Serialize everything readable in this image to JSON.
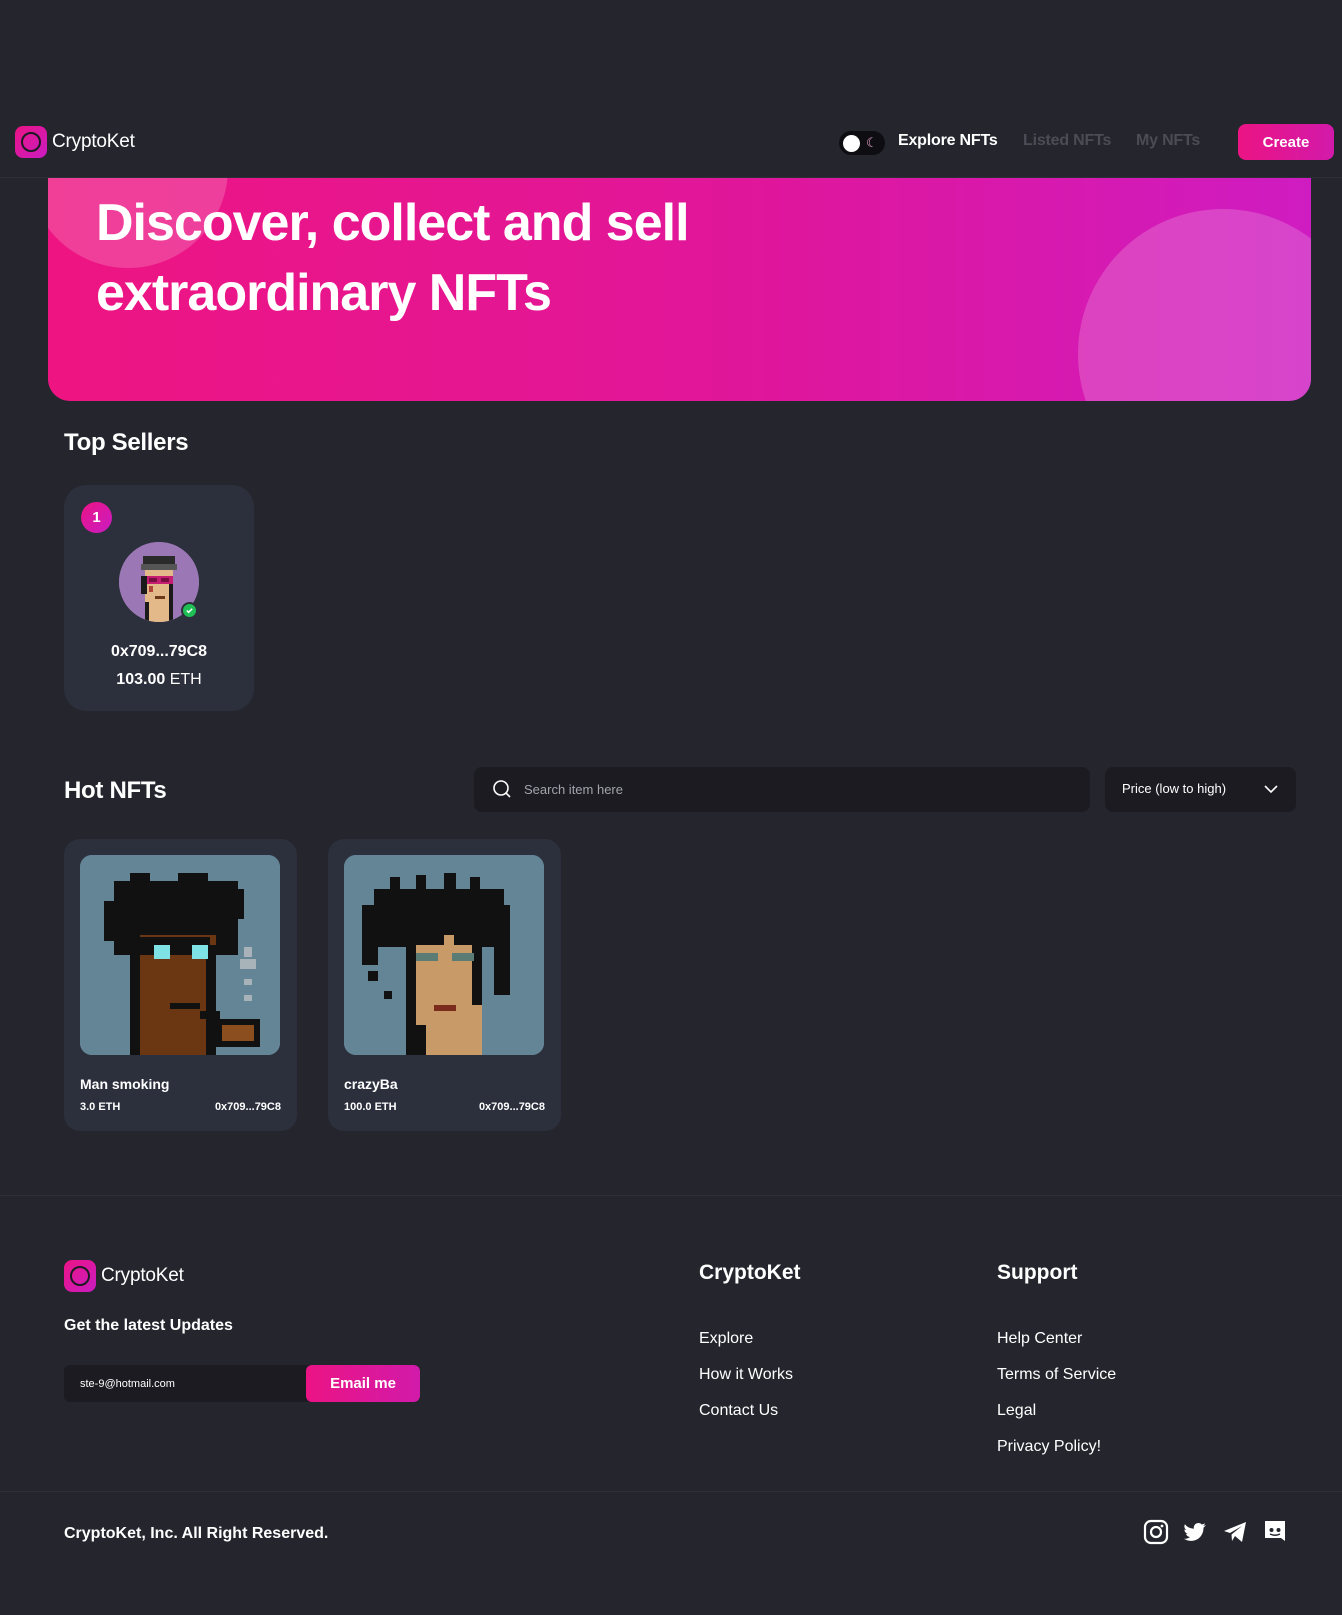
{
  "brand": {
    "name": "CryptoKet"
  },
  "nav": {
    "links": [
      {
        "label": "Explore NFTs",
        "active": true
      },
      {
        "label": "Listed NFTs",
        "active": false
      },
      {
        "label": "My NFTs",
        "active": false
      }
    ],
    "create_label": "Create",
    "theme_icon": "moon-icon"
  },
  "hero": {
    "title_line1": "Discover, collect and sell",
    "title_line2": "extraordinary NFTs"
  },
  "top_sellers": {
    "title": "Top Sellers",
    "sellers": [
      {
        "rank": "1",
        "address": "0x709...79C8",
        "amount": "103.00",
        "currency": "ETH",
        "verified": true
      }
    ]
  },
  "hot_nfts": {
    "title": "Hot NFTs",
    "search": {
      "placeholder": "Search item here",
      "value": ""
    },
    "sort": {
      "selected": "Price (low to high)"
    },
    "items": [
      {
        "name": "Man smoking",
        "price": "3.0 ETH",
        "owner": "0x709...79C8"
      },
      {
        "name": "crazyBa",
        "price": "100.0 ETH",
        "owner": "0x709...79C8"
      }
    ]
  },
  "footer": {
    "updates_title": "Get the latest Updates",
    "email_value": "ste-9@hotmail.com",
    "email_button": "Email me",
    "columns": [
      {
        "title": "CryptoKet",
        "links": [
          "Explore",
          "How it Works",
          "Contact Us"
        ]
      },
      {
        "title": "Support",
        "links": [
          "Help Center",
          "Terms of Service",
          "Legal",
          "Privacy Policy!"
        ]
      }
    ],
    "copyright": "CryptoKet, Inc. All Right Reserved.",
    "social": [
      "instagram-icon",
      "twitter-icon",
      "telegram-icon",
      "discord-icon"
    ]
  },
  "colors": {
    "background": "#24252d",
    "card": "#2c2f3c",
    "input": "#1b1b21",
    "accent_start": "#eb1484",
    "accent_end": "#c91cc3",
    "verified": "#1fbf56"
  }
}
